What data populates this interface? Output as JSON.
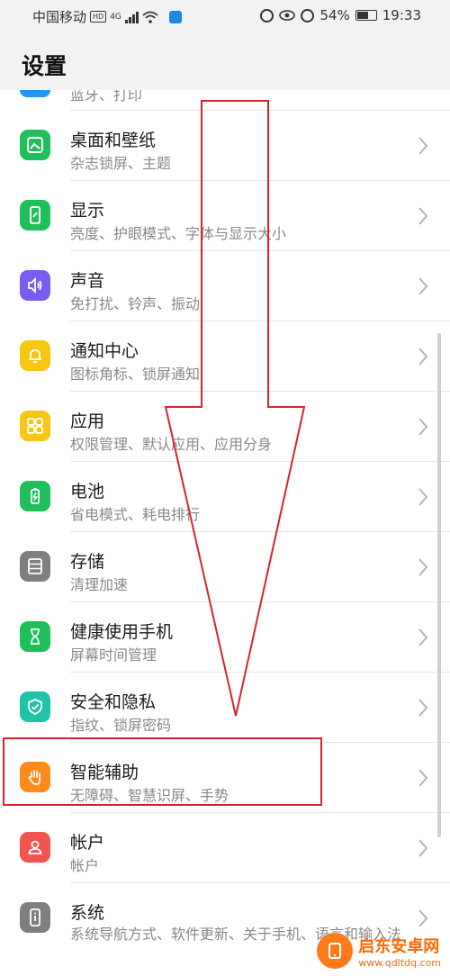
{
  "status_bar": {
    "carrier": "中国移动",
    "hd": "HD",
    "network": "4G",
    "battery": "54%",
    "time": "19:33"
  },
  "header": {
    "title": "设置"
  },
  "clipped_item": {
    "subtitle": "蓝牙、打印"
  },
  "items": [
    {
      "title": "桌面和壁纸",
      "subtitle": "杂志锁屏、主题"
    },
    {
      "title": "显示",
      "subtitle": "亮度、护眼模式、字体与显示大小"
    },
    {
      "title": "声音",
      "subtitle": "免打扰、铃声、振动"
    },
    {
      "title": "通知中心",
      "subtitle": "图标角标、锁屏通知"
    },
    {
      "title": "应用",
      "subtitle": "权限管理、默认应用、应用分身"
    },
    {
      "title": "电池",
      "subtitle": "省电模式、耗电排行"
    },
    {
      "title": "存储",
      "subtitle": "清理加速"
    },
    {
      "title": "健康使用手机",
      "subtitle": "屏幕时间管理"
    },
    {
      "title": "安全和隐私",
      "subtitle": "指纹、锁屏密码"
    },
    {
      "title": "智能辅助",
      "subtitle": "无障碍、智慧识屏、手势"
    },
    {
      "title": "帐户",
      "subtitle": "帐户"
    },
    {
      "title": "系统",
      "subtitle": "系统导航方式、软件更新、关于手机、语言和输入法"
    }
  ],
  "colors": {
    "desktop": "#1fbf5c",
    "display": "#1fbf5c",
    "sound": "#7b5cf0",
    "notification": "#f7c514",
    "apps": "#f7c514",
    "battery": "#1fbf5c",
    "storage": "#7f7f7f",
    "health": "#1fbf5c",
    "security": "#1fc3a8",
    "assist": "#ff8a1e",
    "account": "#f25450",
    "system": "#7f7f7f",
    "annotation": "#d9232c"
  },
  "watermark": {
    "name": "启东安卓网",
    "url": "www.qdltdq.com"
  }
}
